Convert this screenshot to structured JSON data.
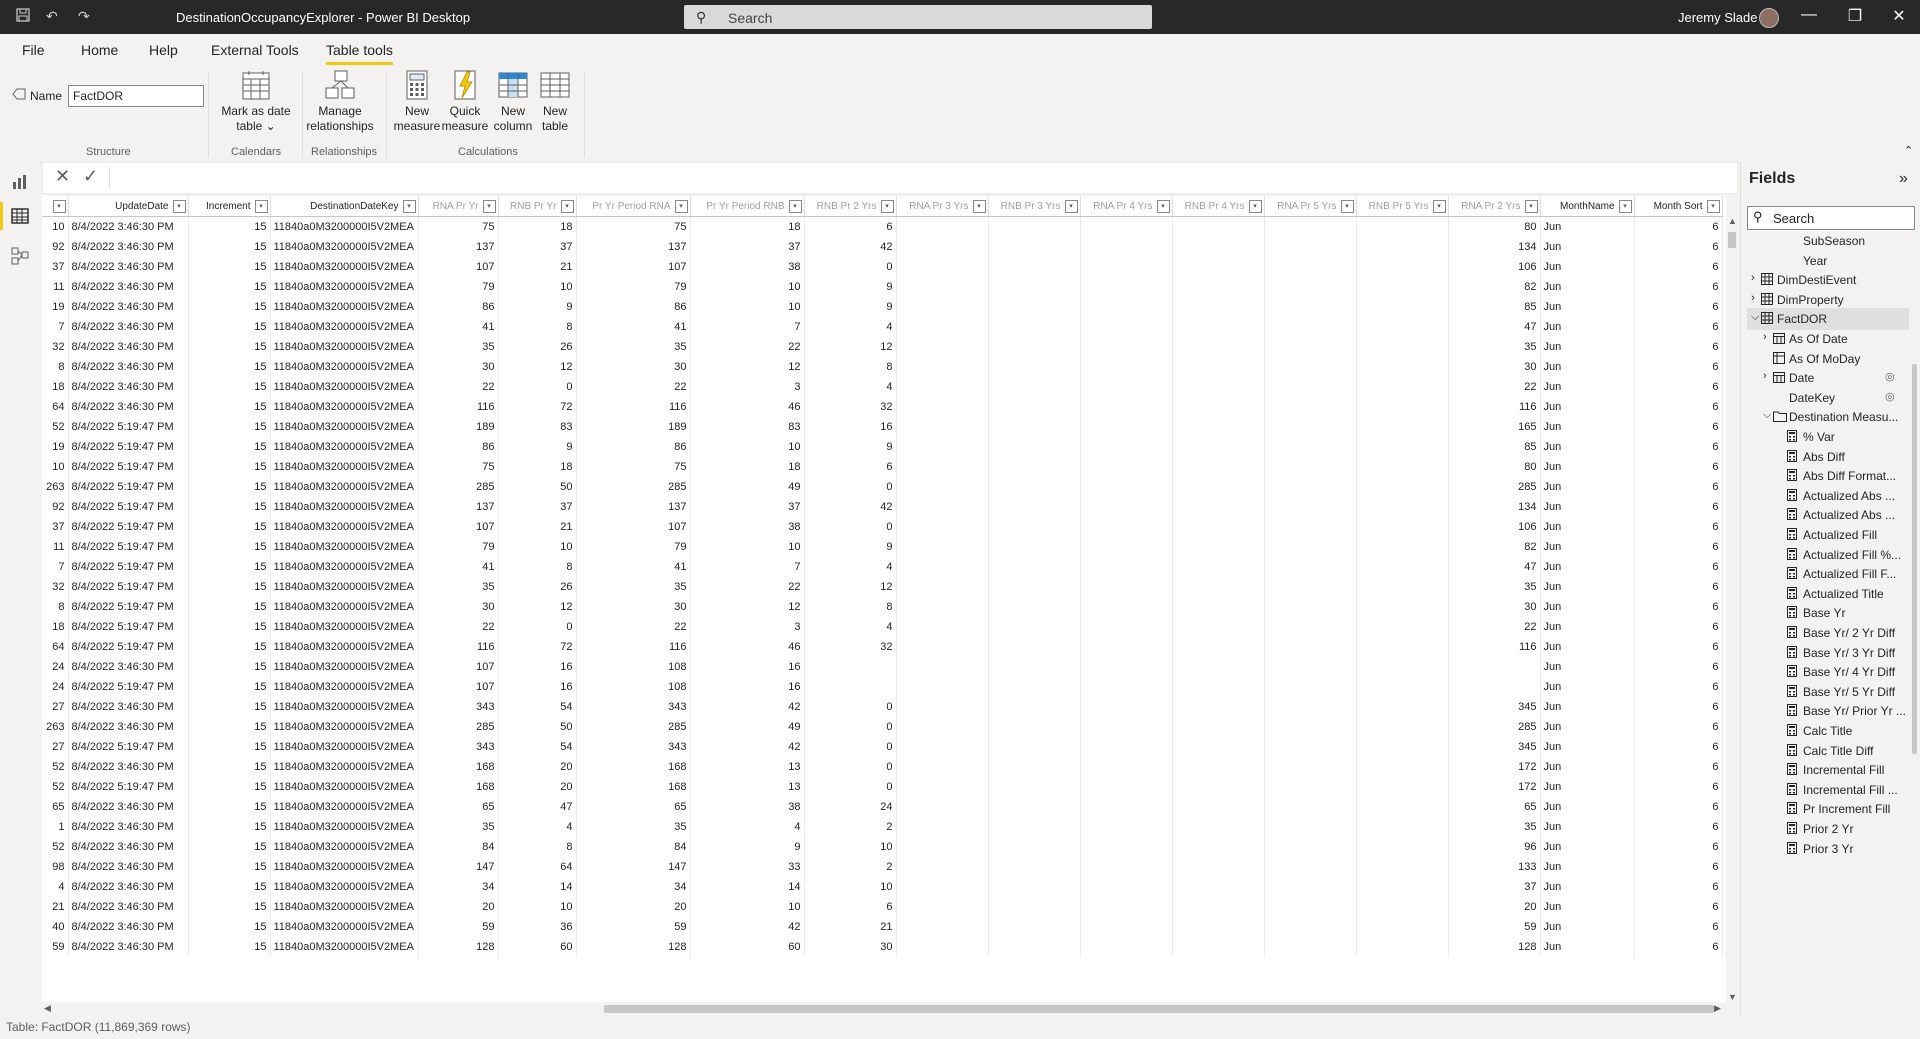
{
  "window": {
    "title": "DestinationOccupancyExplorer - Power BI Desktop",
    "search_placeholder": "Search",
    "user": "Jeremy Slade"
  },
  "menu": {
    "tabs": [
      "File",
      "Home",
      "Help",
      "External Tools",
      "Table tools"
    ],
    "active": "Table tools"
  },
  "ribbon": {
    "name_label": "Name",
    "name_value": "FactDOR",
    "groups": {
      "structure": "Structure",
      "calendars": "Calendars",
      "relationships": "Relationships",
      "calculations": "Calculations"
    },
    "buttons": {
      "mark_date_1": "Mark as date",
      "mark_date_2": "table",
      "manage_rel_1": "Manage",
      "manage_rel_2": "relationships",
      "new_measure_1": "New",
      "new_measure_2": "measure",
      "quick_measure_1": "Quick",
      "quick_measure_2": "measure",
      "new_column_1": "New",
      "new_column_2": "column",
      "new_table_1": "New",
      "new_table_2": "table"
    }
  },
  "grid": {
    "columns": [
      "",
      "UpdateDate",
      "Increment",
      "DestinationDateKey",
      "RNA Pr Yr",
      "RNB Pr Yr",
      "Pr Yr Period RNA",
      "Pr Yr Period RNB",
      "RNB Pr 2 Yrs",
      "RNA Pr 3 Yrs",
      "RNB Pr 3 Yrs",
      "RNA Pr 4 Yrs",
      "RNB Pr 4 Yrs",
      "RNA Pr 5 Yrs",
      "RNB Pr 5 Yrs",
      "RNA Pr 2 Yrs",
      "MonthName",
      "Month Sort"
    ],
    "rows": [
      [
        "10",
        "8/4/2022 3:46:30 PM",
        "15",
        "11840a0M3200000I5V2MEA",
        "75",
        "18",
        "75",
        "18",
        "6",
        "",
        "",
        "",
        "",
        "",
        "",
        "80",
        "Jun",
        "6"
      ],
      [
        "92",
        "8/4/2022 3:46:30 PM",
        "15",
        "11840a0M3200000I5V2MEA",
        "137",
        "37",
        "137",
        "37",
        "42",
        "",
        "",
        "",
        "",
        "",
        "",
        "134",
        "Jun",
        "6"
      ],
      [
        "37",
        "8/4/2022 3:46:30 PM",
        "15",
        "11840a0M3200000I5V2MEA",
        "107",
        "21",
        "107",
        "38",
        "0",
        "",
        "",
        "",
        "",
        "",
        "",
        "106",
        "Jun",
        "6"
      ],
      [
        "11",
        "8/4/2022 3:46:30 PM",
        "15",
        "11840a0M3200000I5V2MEA",
        "79",
        "10",
        "79",
        "10",
        "9",
        "",
        "",
        "",
        "",
        "",
        "",
        "82",
        "Jun",
        "6"
      ],
      [
        "19",
        "8/4/2022 3:46:30 PM",
        "15",
        "11840a0M3200000I5V2MEA",
        "86",
        "9",
        "86",
        "10",
        "9",
        "",
        "",
        "",
        "",
        "",
        "",
        "85",
        "Jun",
        "6"
      ],
      [
        "7",
        "8/4/2022 3:46:30 PM",
        "15",
        "11840a0M3200000I5V2MEA",
        "41",
        "8",
        "41",
        "7",
        "4",
        "",
        "",
        "",
        "",
        "",
        "",
        "47",
        "Jun",
        "6"
      ],
      [
        "32",
        "8/4/2022 3:46:30 PM",
        "15",
        "11840a0M3200000I5V2MEA",
        "35",
        "26",
        "35",
        "22",
        "12",
        "",
        "",
        "",
        "",
        "",
        "",
        "35",
        "Jun",
        "6"
      ],
      [
        "8",
        "8/4/2022 3:46:30 PM",
        "15",
        "11840a0M3200000I5V2MEA",
        "30",
        "12",
        "30",
        "12",
        "8",
        "",
        "",
        "",
        "",
        "",
        "",
        "30",
        "Jun",
        "6"
      ],
      [
        "18",
        "8/4/2022 3:46:30 PM",
        "15",
        "11840a0M3200000I5V2MEA",
        "22",
        "0",
        "22",
        "3",
        "4",
        "",
        "",
        "",
        "",
        "",
        "",
        "22",
        "Jun",
        "6"
      ],
      [
        "64",
        "8/4/2022 3:46:30 PM",
        "15",
        "11840a0M3200000I5V2MEA",
        "116",
        "72",
        "116",
        "46",
        "32",
        "",
        "",
        "",
        "",
        "",
        "",
        "116",
        "Jun",
        "6"
      ],
      [
        "52",
        "8/4/2022 5:19:47 PM",
        "15",
        "11840a0M3200000I5V2MEA",
        "189",
        "83",
        "189",
        "83",
        "16",
        "",
        "",
        "",
        "",
        "",
        "",
        "165",
        "Jun",
        "6"
      ],
      [
        "19",
        "8/4/2022 5:19:47 PM",
        "15",
        "11840a0M3200000I5V2MEA",
        "86",
        "9",
        "86",
        "10",
        "9",
        "",
        "",
        "",
        "",
        "",
        "",
        "85",
        "Jun",
        "6"
      ],
      [
        "10",
        "8/4/2022 5:19:47 PM",
        "15",
        "11840a0M3200000I5V2MEA",
        "75",
        "18",
        "75",
        "18",
        "6",
        "",
        "",
        "",
        "",
        "",
        "",
        "80",
        "Jun",
        "6"
      ],
      [
        "263",
        "8/4/2022 5:19:47 PM",
        "15",
        "11840a0M3200000I5V2MEA",
        "285",
        "50",
        "285",
        "49",
        "0",
        "",
        "",
        "",
        "",
        "",
        "",
        "285",
        "Jun",
        "6"
      ],
      [
        "92",
        "8/4/2022 5:19:47 PM",
        "15",
        "11840a0M3200000I5V2MEA",
        "137",
        "37",
        "137",
        "37",
        "42",
        "",
        "",
        "",
        "",
        "",
        "",
        "134",
        "Jun",
        "6"
      ],
      [
        "37",
        "8/4/2022 5:19:47 PM",
        "15",
        "11840a0M3200000I5V2MEA",
        "107",
        "21",
        "107",
        "38",
        "0",
        "",
        "",
        "",
        "",
        "",
        "",
        "106",
        "Jun",
        "6"
      ],
      [
        "11",
        "8/4/2022 5:19:47 PM",
        "15",
        "11840a0M3200000I5V2MEA",
        "79",
        "10",
        "79",
        "10",
        "9",
        "",
        "",
        "",
        "",
        "",
        "",
        "82",
        "Jun",
        "6"
      ],
      [
        "7",
        "8/4/2022 5:19:47 PM",
        "15",
        "11840a0M3200000I5V2MEA",
        "41",
        "8",
        "41",
        "7",
        "4",
        "",
        "",
        "",
        "",
        "",
        "",
        "47",
        "Jun",
        "6"
      ],
      [
        "32",
        "8/4/2022 5:19:47 PM",
        "15",
        "11840a0M3200000I5V2MEA",
        "35",
        "26",
        "35",
        "22",
        "12",
        "",
        "",
        "",
        "",
        "",
        "",
        "35",
        "Jun",
        "6"
      ],
      [
        "8",
        "8/4/2022 5:19:47 PM",
        "15",
        "11840a0M3200000I5V2MEA",
        "30",
        "12",
        "30",
        "12",
        "8",
        "",
        "",
        "",
        "",
        "",
        "",
        "30",
        "Jun",
        "6"
      ],
      [
        "18",
        "8/4/2022 5:19:47 PM",
        "15",
        "11840a0M3200000I5V2MEA",
        "22",
        "0",
        "22",
        "3",
        "4",
        "",
        "",
        "",
        "",
        "",
        "",
        "22",
        "Jun",
        "6"
      ],
      [
        "64",
        "8/4/2022 5:19:47 PM",
        "15",
        "11840a0M3200000I5V2MEA",
        "116",
        "72",
        "116",
        "46",
        "32",
        "",
        "",
        "",
        "",
        "",
        "",
        "116",
        "Jun",
        "6"
      ],
      [
        "24",
        "8/4/2022 3:46:30 PM",
        "15",
        "11840a0M3200000I5V2MEA",
        "107",
        "16",
        "108",
        "16",
        "",
        "",
        "",
        "",
        "",
        "",
        "",
        "",
        "Jun",
        "6"
      ],
      [
        "24",
        "8/4/2022 5:19:47 PM",
        "15",
        "11840a0M3200000I5V2MEA",
        "107",
        "16",
        "108",
        "16",
        "",
        "",
        "",
        "",
        "",
        "",
        "",
        "",
        "Jun",
        "6"
      ],
      [
        "27",
        "8/4/2022 3:46:30 PM",
        "15",
        "11840a0M3200000I5V2MEA",
        "343",
        "54",
        "343",
        "42",
        "0",
        "",
        "",
        "",
        "",
        "",
        "",
        "345",
        "Jun",
        "6"
      ],
      [
        "263",
        "8/4/2022 3:46:30 PM",
        "15",
        "11840a0M3200000I5V2MEA",
        "285",
        "50",
        "285",
        "49",
        "0",
        "",
        "",
        "",
        "",
        "",
        "",
        "285",
        "Jun",
        "6"
      ],
      [
        "27",
        "8/4/2022 5:19:47 PM",
        "15",
        "11840a0M3200000I5V2MEA",
        "343",
        "54",
        "343",
        "42",
        "0",
        "",
        "",
        "",
        "",
        "",
        "",
        "345",
        "Jun",
        "6"
      ],
      [
        "52",
        "8/4/2022 3:46:30 PM",
        "15",
        "11840a0M3200000I5V2MEA",
        "168",
        "20",
        "168",
        "13",
        "0",
        "",
        "",
        "",
        "",
        "",
        "",
        "172",
        "Jun",
        "6"
      ],
      [
        "52",
        "8/4/2022 5:19:47 PM",
        "15",
        "11840a0M3200000I5V2MEA",
        "168",
        "20",
        "168",
        "13",
        "0",
        "",
        "",
        "",
        "",
        "",
        "",
        "172",
        "Jun",
        "6"
      ],
      [
        "65",
        "8/4/2022 3:46:30 PM",
        "15",
        "11840a0M3200000I5V2MEA",
        "65",
        "47",
        "65",
        "38",
        "24",
        "",
        "",
        "",
        "",
        "",
        "",
        "65",
        "Jun",
        "6"
      ],
      [
        "1",
        "8/4/2022 3:46:30 PM",
        "15",
        "11840a0M3200000I5V2MEA",
        "35",
        "4",
        "35",
        "4",
        "2",
        "",
        "",
        "",
        "",
        "",
        "",
        "35",
        "Jun",
        "6"
      ],
      [
        "52",
        "8/4/2022 3:46:30 PM",
        "15",
        "11840a0M3200000I5V2MEA",
        "84",
        "8",
        "84",
        "9",
        "10",
        "",
        "",
        "",
        "",
        "",
        "",
        "96",
        "Jun",
        "6"
      ],
      [
        "98",
        "8/4/2022 3:46:30 PM",
        "15",
        "11840a0M3200000I5V2MEA",
        "147",
        "64",
        "147",
        "33",
        "2",
        "",
        "",
        "",
        "",
        "",
        "",
        "133",
        "Jun",
        "6"
      ],
      [
        "4",
        "8/4/2022 3:46:30 PM",
        "15",
        "11840a0M3200000I5V2MEA",
        "34",
        "14",
        "34",
        "14",
        "10",
        "",
        "",
        "",
        "",
        "",
        "",
        "37",
        "Jun",
        "6"
      ],
      [
        "21",
        "8/4/2022 3:46:30 PM",
        "15",
        "11840a0M3200000I5V2MEA",
        "20",
        "10",
        "20",
        "10",
        "6",
        "",
        "",
        "",
        "",
        "",
        "",
        "20",
        "Jun",
        "6"
      ],
      [
        "40",
        "8/4/2022 3:46:30 PM",
        "15",
        "11840a0M3200000I5V2MEA",
        "59",
        "36",
        "59",
        "42",
        "21",
        "",
        "",
        "",
        "",
        "",
        "",
        "59",
        "Jun",
        "6"
      ],
      [
        "59",
        "8/4/2022 3:46:30 PM",
        "15",
        "11840a0M3200000I5V2MEA",
        "128",
        "60",
        "128",
        "60",
        "30",
        "",
        "",
        "",
        "",
        "",
        "",
        "128",
        "Jun",
        "6"
      ]
    ]
  },
  "status": {
    "text": "Table: FactDOR (11,869,369 rows)"
  },
  "fields_pane": {
    "title": "Fields",
    "search_placeholder": "Search",
    "items": [
      {
        "label": "SubSeason",
        "level": 2,
        "icon": "none",
        "chev": ""
      },
      {
        "label": "Year",
        "level": 2,
        "icon": "none",
        "chev": ""
      },
      {
        "label": "DimDestiEvent",
        "level": 0,
        "icon": "table",
        "chev": "right"
      },
      {
        "label": "DimProperty",
        "level": 0,
        "icon": "table",
        "chev": "right"
      },
      {
        "label": "FactDOR",
        "level": 0,
        "icon": "table",
        "chev": "down",
        "selected": true
      },
      {
        "label": "As Of Date",
        "level": 1,
        "icon": "calendar",
        "chev": "right"
      },
      {
        "label": "As Of MoDay",
        "level": 1,
        "icon": "calc-table",
        "chev": ""
      },
      {
        "label": "Date",
        "level": 1,
        "icon": "calendar",
        "chev": "right",
        "hidden": true
      },
      {
        "label": "DateKey",
        "level": 1,
        "icon": "none",
        "chev": "",
        "hidden": true
      },
      {
        "label": "Destination Measu...",
        "level": 1,
        "icon": "folder",
        "chev": "down"
      },
      {
        "label": "% Var",
        "level": 2,
        "icon": "measure",
        "chev": ""
      },
      {
        "label": "Abs Diff",
        "level": 2,
        "icon": "measure",
        "chev": ""
      },
      {
        "label": "Abs Diff Format...",
        "level": 2,
        "icon": "measure",
        "chev": ""
      },
      {
        "label": "Actualized Abs ...",
        "level": 2,
        "icon": "measure",
        "chev": ""
      },
      {
        "label": "Actualized Abs ...",
        "level": 2,
        "icon": "measure",
        "chev": ""
      },
      {
        "label": "Actualized Fill",
        "level": 2,
        "icon": "measure",
        "chev": ""
      },
      {
        "label": "Actualized Fill %...",
        "level": 2,
        "icon": "measure",
        "chev": ""
      },
      {
        "label": "Actualized Fill F...",
        "level": 2,
        "icon": "measure",
        "chev": ""
      },
      {
        "label": "Actualized Title",
        "level": 2,
        "icon": "measure",
        "chev": ""
      },
      {
        "label": "Base Yr",
        "level": 2,
        "icon": "measure",
        "chev": ""
      },
      {
        "label": "Base Yr/ 2 Yr Diff",
        "level": 2,
        "icon": "measure",
        "chev": ""
      },
      {
        "label": "Base Yr/ 3 Yr Diff",
        "level": 2,
        "icon": "measure",
        "chev": ""
      },
      {
        "label": "Base Yr/ 4 Yr Diff",
        "level": 2,
        "icon": "measure",
        "chev": ""
      },
      {
        "label": "Base Yr/ 5 Yr Diff",
        "level": 2,
        "icon": "measure",
        "chev": ""
      },
      {
        "label": "Base Yr/ Prior Yr ...",
        "level": 2,
        "icon": "measure",
        "chev": ""
      },
      {
        "label": "Calc Title",
        "level": 2,
        "icon": "measure",
        "chev": ""
      },
      {
        "label": "Calc Title Diff",
        "level": 2,
        "icon": "measure",
        "chev": ""
      },
      {
        "label": "Incremental Fill",
        "level": 2,
        "icon": "measure",
        "chev": ""
      },
      {
        "label": "Incremental Fill ...",
        "level": 2,
        "icon": "measure",
        "chev": ""
      },
      {
        "label": "Pr Increment Fill",
        "level": 2,
        "icon": "measure",
        "chev": ""
      },
      {
        "label": "Prior 2 Yr",
        "level": 2,
        "icon": "measure",
        "chev": ""
      },
      {
        "label": "Prior 3 Yr",
        "level": 2,
        "icon": "measure",
        "chev": ""
      }
    ]
  },
  "colors": {
    "accent": "#f2c811",
    "titlebar": "#282828"
  }
}
